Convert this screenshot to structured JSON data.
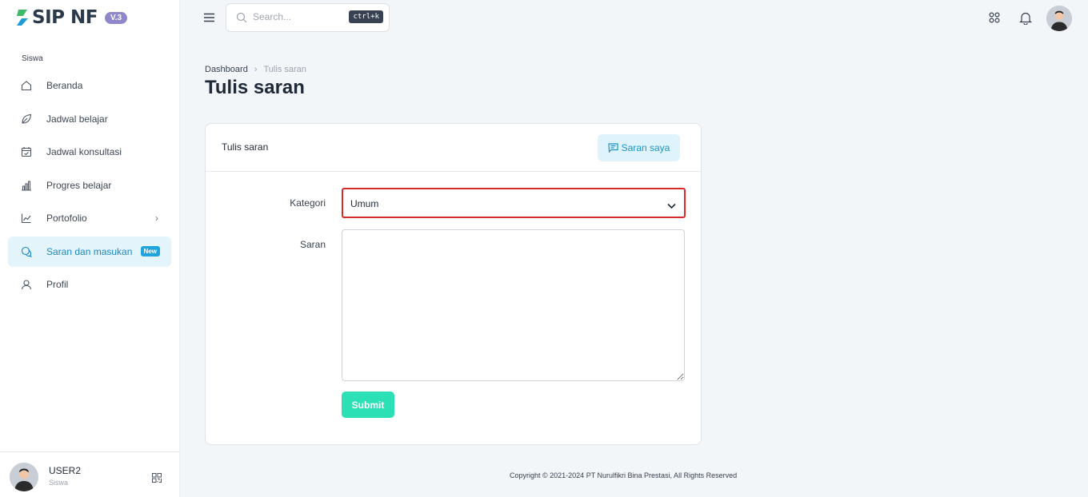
{
  "app": {
    "brand": "SIP NF",
    "version": "V.3"
  },
  "sidebar": {
    "section_label": "Siswa",
    "items": [
      {
        "label": "Beranda",
        "icon": "home-icon"
      },
      {
        "label": "Jadwal belajar",
        "icon": "leaf-icon"
      },
      {
        "label": "Jadwal konsultasi",
        "icon": "calendar-check-icon"
      },
      {
        "label": "Progres belajar",
        "icon": "bar-chart-icon"
      },
      {
        "label": "Portofolio",
        "icon": "line-chart-icon"
      },
      {
        "label": "Saran dan masukan",
        "icon": "chat-icon",
        "badge": "New",
        "active": true
      },
      {
        "label": "Profil",
        "icon": "user-icon"
      }
    ],
    "user": {
      "name": "USER2",
      "role": "Siswa"
    }
  },
  "topbar": {
    "search_placeholder": "Search...",
    "shortcut": "ctrl+k"
  },
  "breadcrumb": {
    "home": "Dashboard",
    "current": "Tulis saran"
  },
  "page_title": "Tulis saran",
  "card": {
    "title": "Tulis saran",
    "action_button": "Saran saya",
    "form": {
      "kategori_label": "Kategori",
      "kategori_value": "Umum",
      "saran_label": "Saran",
      "saran_value": "",
      "submit_label": "Submit"
    }
  },
  "footer": {
    "copyright": "Copyright © 2021-2024 PT Nurulfikri Bina Prestasi, All Rights Reserved"
  },
  "colors": {
    "accent": "#1b8ac2",
    "submit": "#2ae0b4",
    "highlight_border": "#d92a2a",
    "badge": "#8e87c9"
  }
}
